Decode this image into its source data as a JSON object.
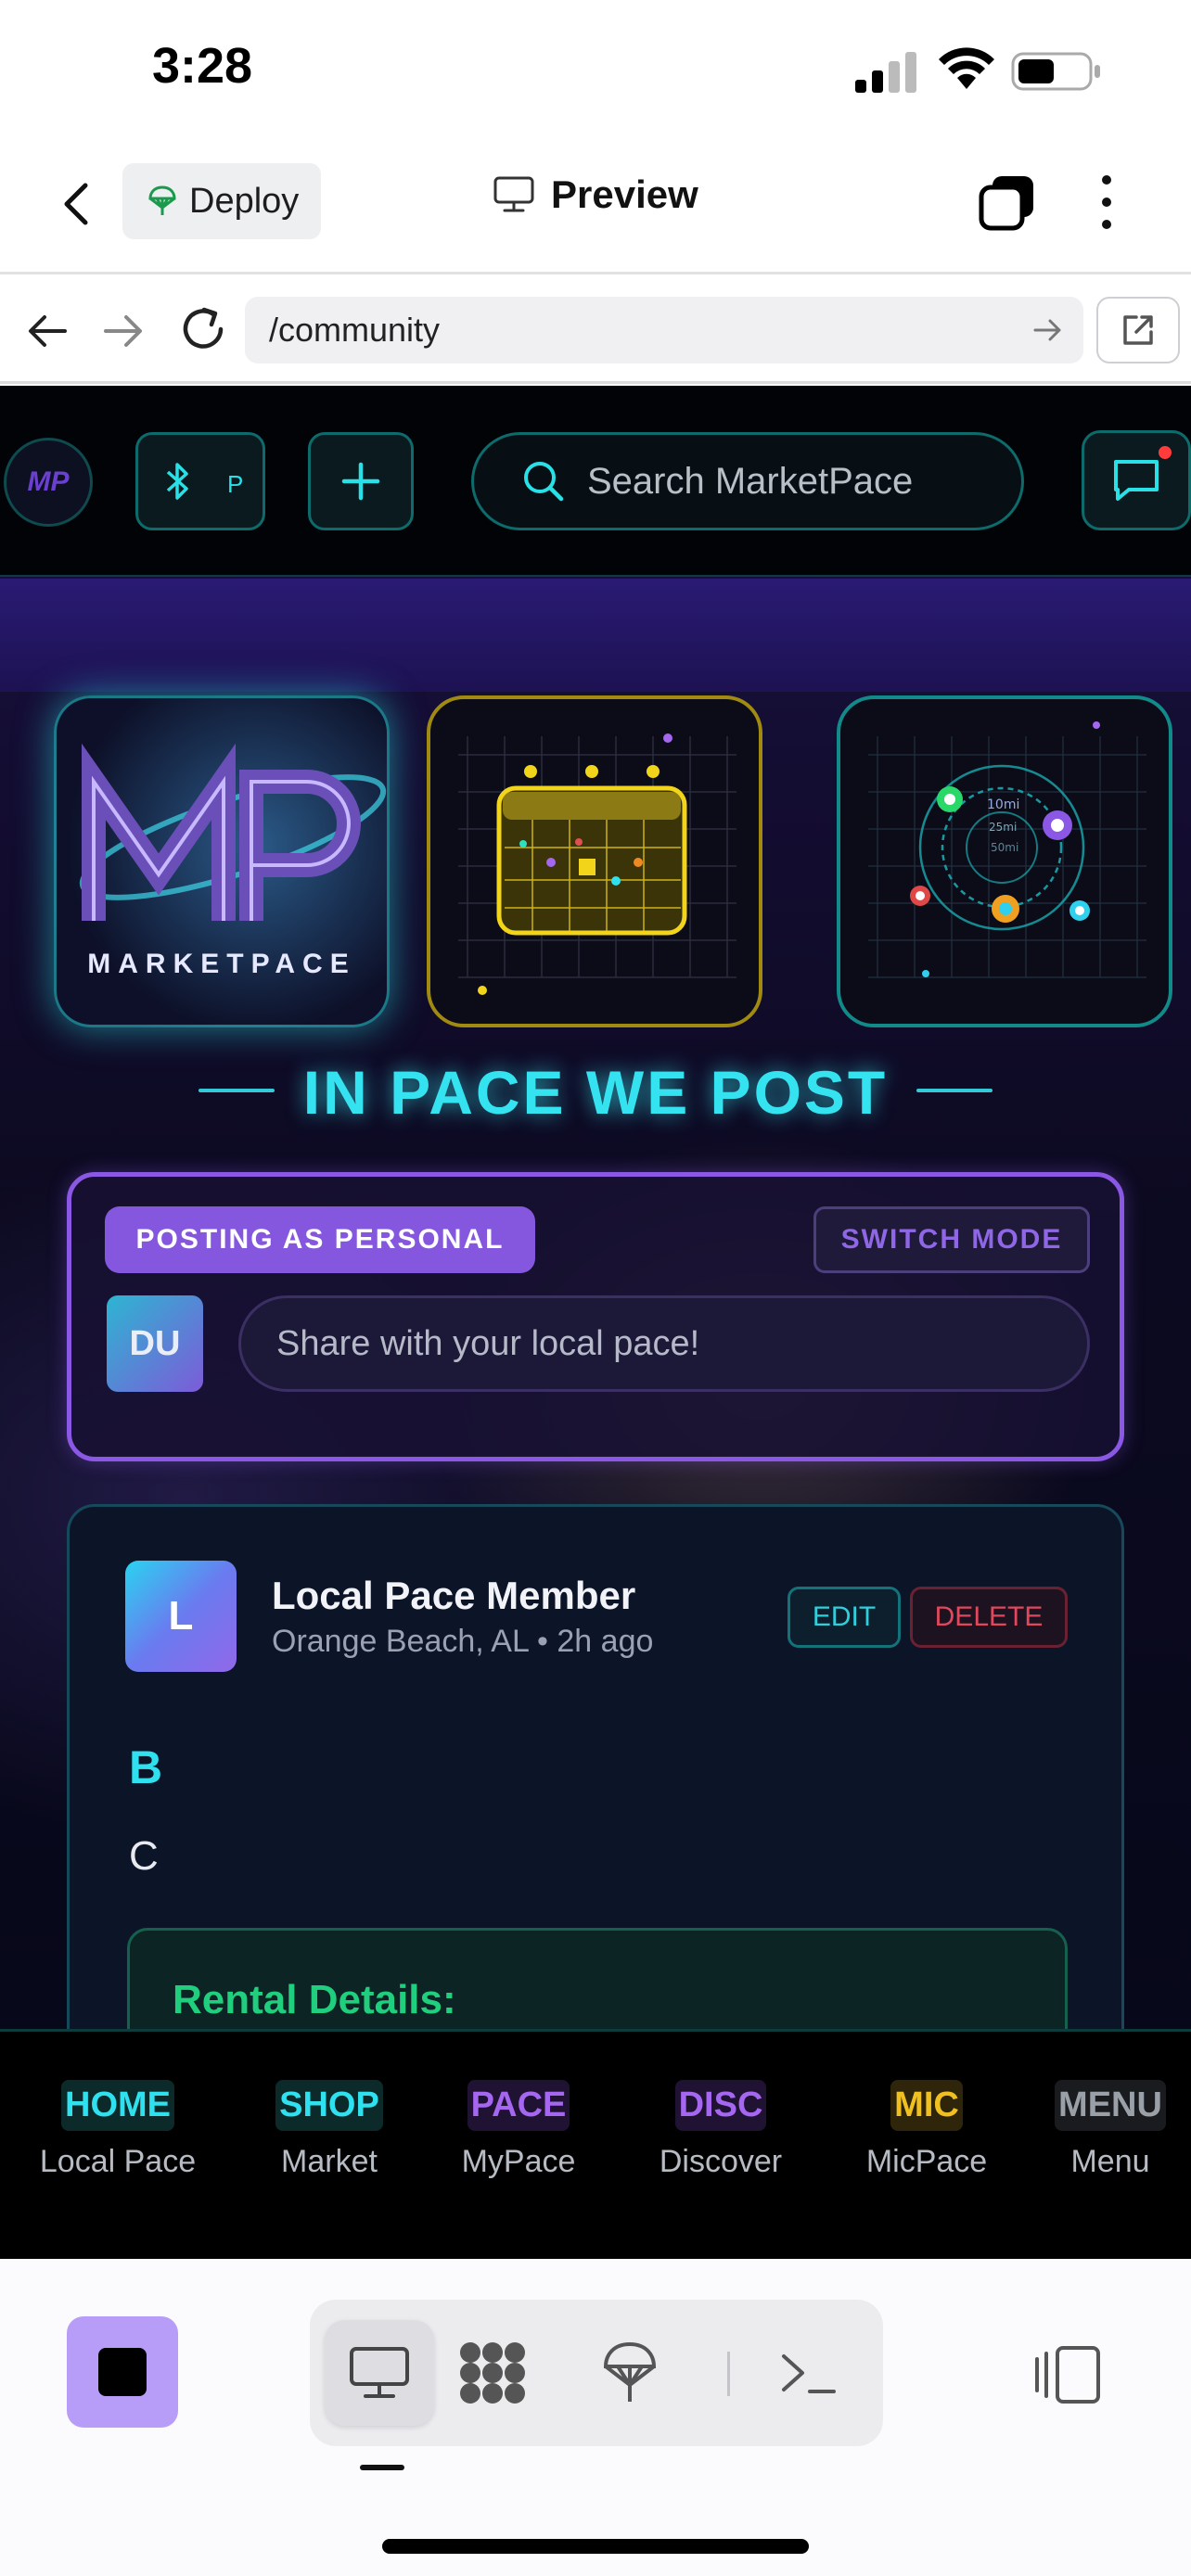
{
  "status_bar": {
    "time": "3:28",
    "icons": [
      "signal-icon",
      "wifi-icon",
      "battery-icon"
    ]
  },
  "header": {
    "deploy_label": "Deploy",
    "title": "Preview"
  },
  "browser": {
    "url": "/community"
  },
  "site": {
    "logo_initials": "MP",
    "chip_left": "B",
    "chip_right": "P",
    "search_placeholder": "Search MarketPace",
    "hero_logo_word": "MARKETPACE",
    "map_labels": [
      "10mi",
      "25mi",
      "50mi"
    ],
    "headline": "IN PACE WE POST",
    "colors": {
      "accent_cyan": "#35e3f0",
      "accent_purple": "#8557df",
      "accent_green": "#1fcf7e",
      "danger": "#e0485d"
    }
  },
  "composer": {
    "posting_as": "POSTING AS PERSONAL",
    "switch_mode": "SWITCH MODE",
    "avatar_initials": "DU",
    "placeholder": "Share with your local pace!"
  },
  "post": {
    "avatar_initial": "L",
    "author": "Local Pace Member",
    "meta": "Orange Beach, AL • 2h ago",
    "edit_label": "EDIT",
    "delete_label": "DELETE",
    "title": "B",
    "body": "C",
    "rental_title": "Rental Details:"
  },
  "bottom_nav": [
    {
      "tag": "HOME",
      "label": "Local Pace",
      "color": "#2fe0ee",
      "bg": "#0d2a2a"
    },
    {
      "tag": "SHOP",
      "label": "Market",
      "color": "#2fe0ee",
      "bg": "#0d2a2a"
    },
    {
      "tag": "PACE",
      "label": "MyPace",
      "color": "#a566f0",
      "bg": "#1f1232"
    },
    {
      "tag": "DISC",
      "label": "Discover",
      "color": "#a566f0",
      "bg": "#1f1232"
    },
    {
      "tag": "MIC",
      "label": "MicPace",
      "color": "#f0c020",
      "bg": "#2e250a"
    },
    {
      "tag": "MENU",
      "label": "Menu",
      "color": "#9aa0a8",
      "bg": "#1a1b1e"
    }
  ]
}
